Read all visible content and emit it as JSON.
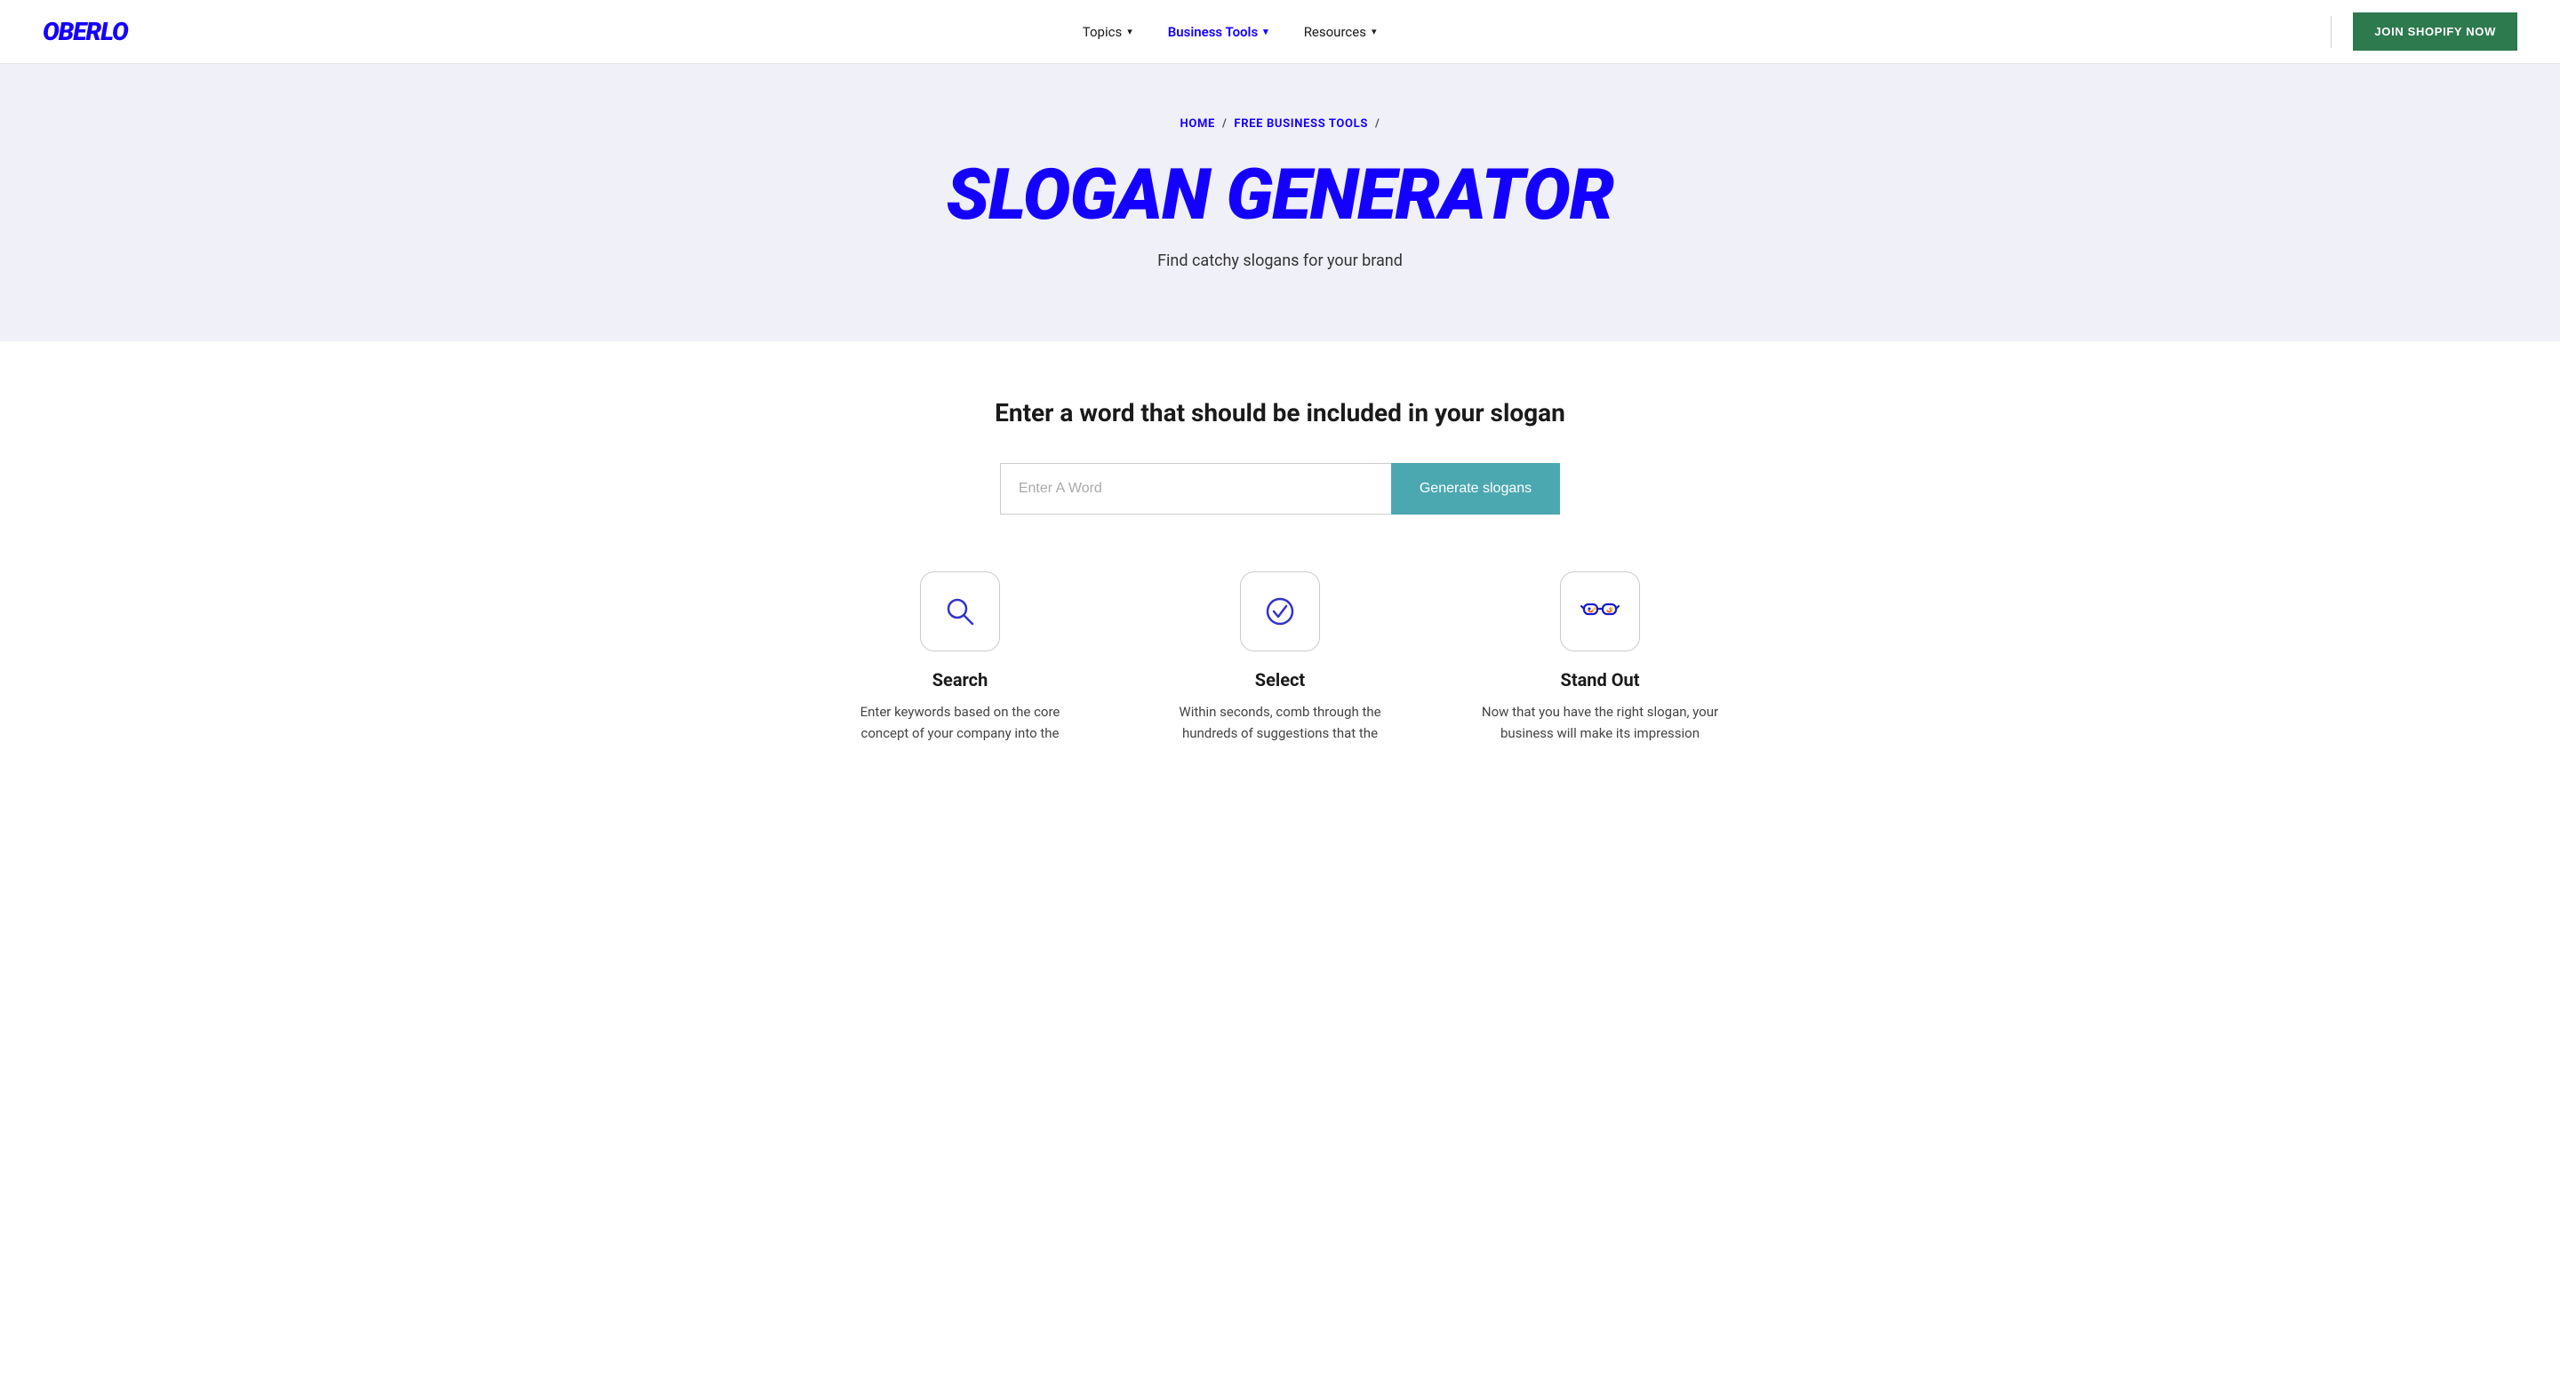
{
  "brand": {
    "logo": "OBERLO"
  },
  "navbar": {
    "topics_label": "Topics",
    "business_tools_label": "Business Tools",
    "resources_label": "Resources",
    "join_button": "JOIN SHOPIFY NOW"
  },
  "hero": {
    "breadcrumb_home": "HOME",
    "breadcrumb_sep1": "/",
    "breadcrumb_link": "FREE BUSINESS TOOLS",
    "breadcrumb_sep2": "/",
    "title": "SLOGAN GENERATOR",
    "subtitle": "Find catchy slogans for your brand"
  },
  "main": {
    "section_heading": "Enter a word that should be included in your slogan",
    "input_placeholder": "Enter A Word",
    "generate_button": "Generate slogans"
  },
  "features": [
    {
      "id": "search",
      "icon": "search-icon",
      "title": "Search",
      "description": "Enter keywords based on the core concept of your company into the"
    },
    {
      "id": "select",
      "icon": "check-circle-icon",
      "title": "Select",
      "description": "Within seconds, comb through the hundreds of suggestions that the"
    },
    {
      "id": "stand-out",
      "icon": "glasses-icon",
      "title": "Stand Out",
      "description": "Now that you have the right slogan, your business will make its impression"
    }
  ],
  "colors": {
    "brand_blue": "#1400ff",
    "hero_bg": "#f0f0f8",
    "join_btn_bg": "#2d7a4f",
    "generate_btn_bg": "#4ca8b0"
  }
}
